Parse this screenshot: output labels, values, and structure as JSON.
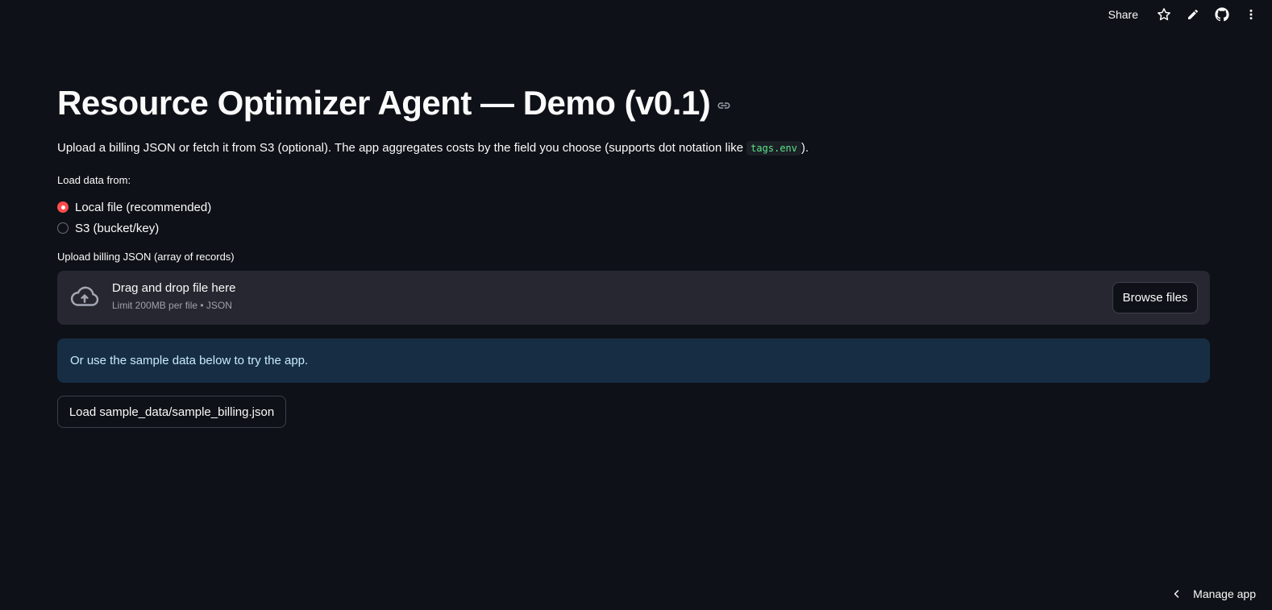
{
  "toolbar": {
    "share_label": "Share",
    "icons": [
      "star-icon",
      "pencil-icon",
      "github-icon",
      "kebab-menu-icon"
    ]
  },
  "page": {
    "title": "Resource Optimizer Agent — Demo (v0.1)",
    "description_before": "Upload a billing JSON or fetch it from S3 (optional). The app aggregates costs by the field you choose (supports dot notation like ",
    "description_code": "tags.env",
    "description_after": ")."
  },
  "data_source": {
    "label": "Load data from:",
    "options": [
      {
        "label": "Local file (recommended)",
        "selected": true
      },
      {
        "label": "S3 (bucket/key)",
        "selected": false
      }
    ]
  },
  "uploader": {
    "label": "Upload billing JSON (array of records)",
    "drop_text": "Drag and drop file here",
    "limit_text": "Limit 200MB per file • JSON",
    "browse_label": "Browse files"
  },
  "info": {
    "text": "Or use the sample data below to try the app."
  },
  "sample_button": {
    "label": "Load sample_data/sample_billing.json"
  },
  "footer": {
    "manage_label": "Manage app"
  },
  "colors": {
    "background": "#0e1117",
    "accent": "#ff4b4b",
    "info_bg": "#172d43",
    "uploader_bg": "#262730",
    "code_text": "#5ce488"
  }
}
